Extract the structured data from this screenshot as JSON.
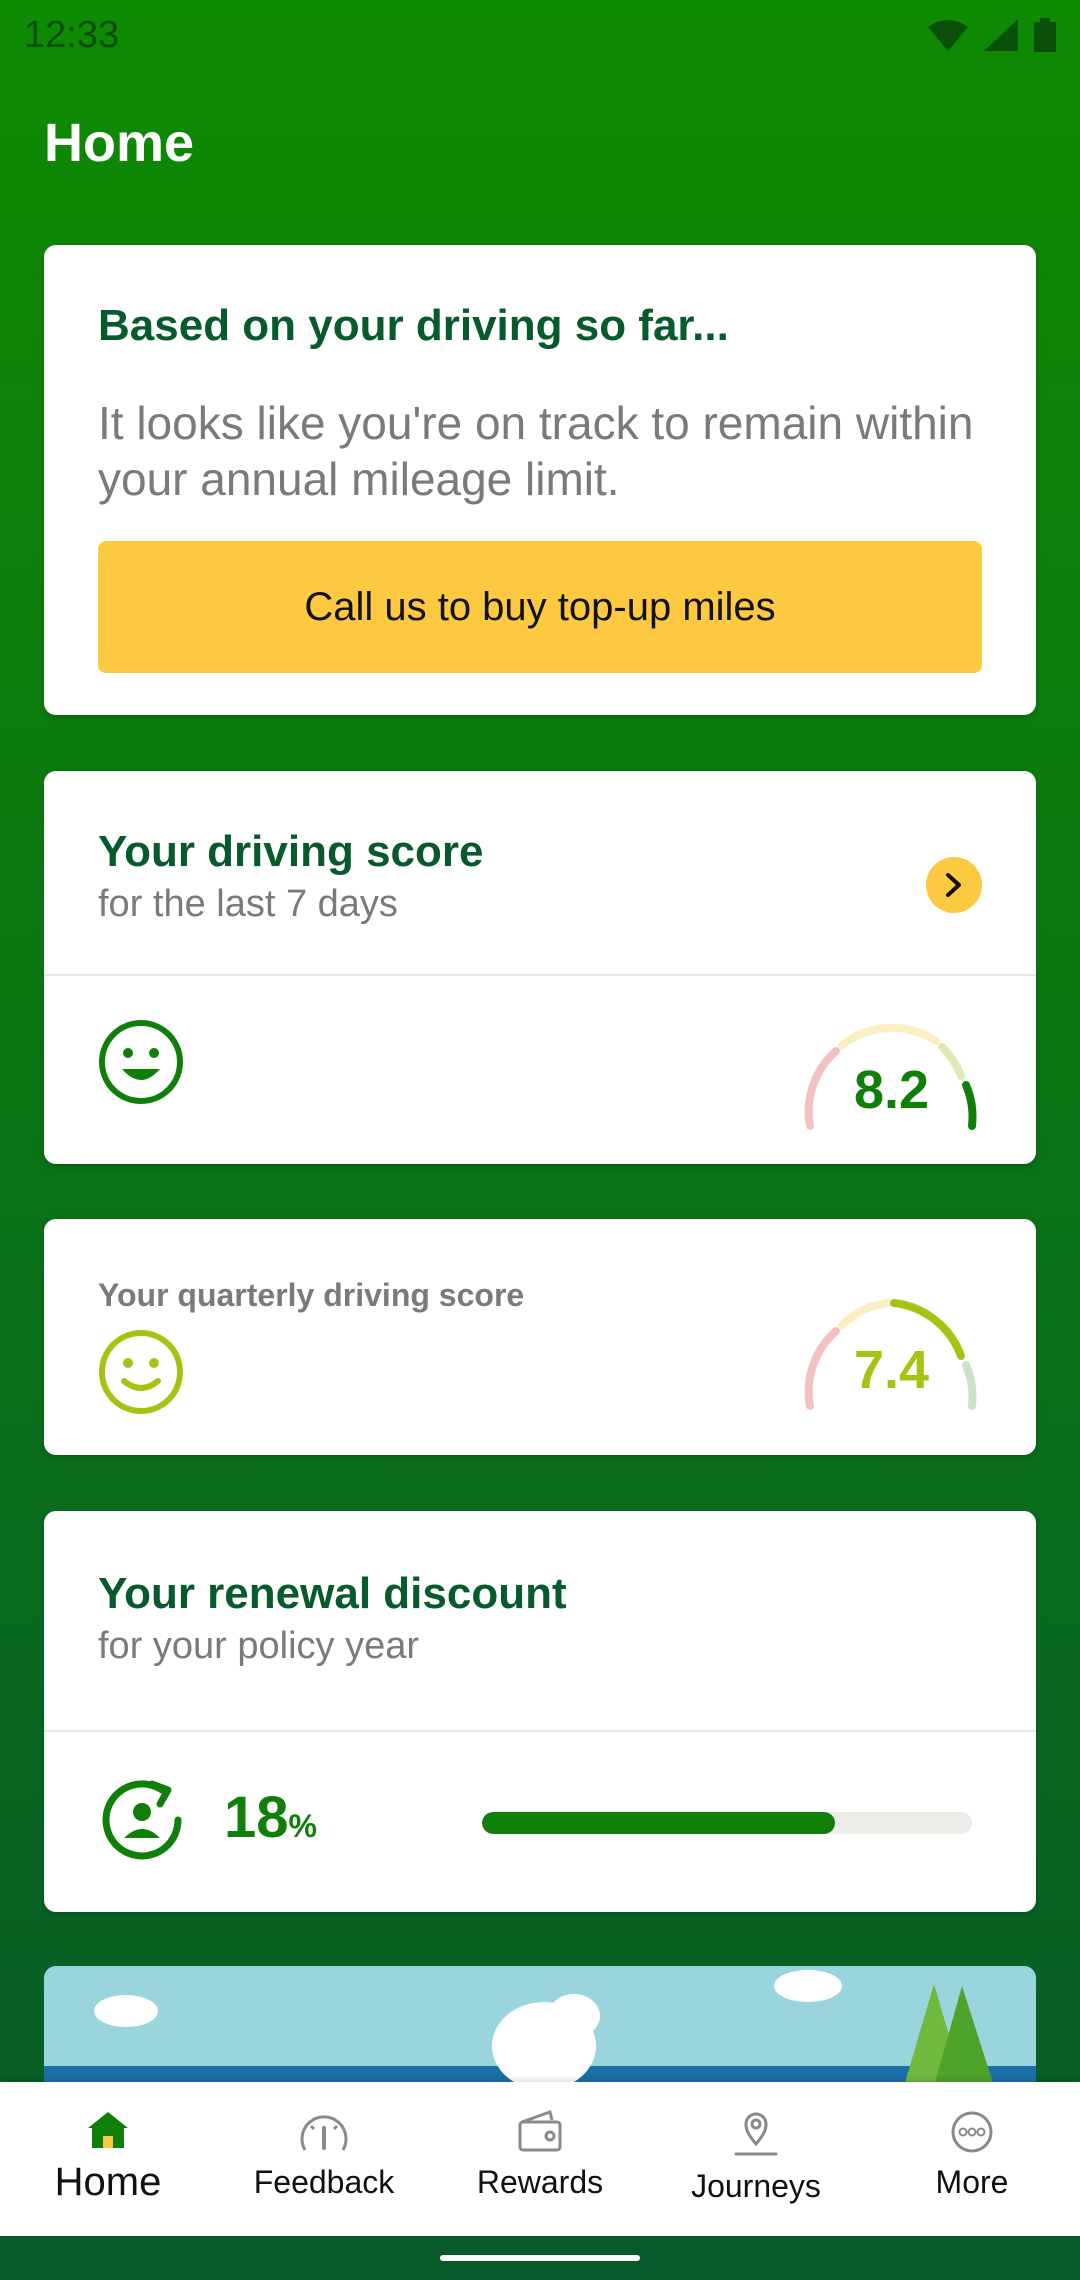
{
  "status_bar": {
    "time": "12:33"
  },
  "header": {
    "title": "Home"
  },
  "mileage_card": {
    "title": "Based on your driving so far...",
    "body": "It looks like you're on track to remain within your annual mileage limit.",
    "cta_label": "Call us to buy top-up miles"
  },
  "weekly_score": {
    "title": "Your driving score",
    "subtitle": "for the last 7 days",
    "score": "8.2",
    "score_color": "#0f7f0a"
  },
  "quarterly_score": {
    "title": "Your quarterly driving score",
    "score": "7.4",
    "score_color": "#a8c214"
  },
  "renewal": {
    "title": "Your renewal discount",
    "subtitle": "for your policy year",
    "value": "18",
    "unit": "%",
    "progress_fraction": 0.72
  },
  "bottom_nav": {
    "items": [
      {
        "label": "Home",
        "icon": "home-icon",
        "active": true
      },
      {
        "label": "Feedback",
        "icon": "speedometer-icon",
        "active": false
      },
      {
        "label": "Rewards",
        "icon": "wallet-icon",
        "active": false
      },
      {
        "label": "Journeys",
        "icon": "location-pin-icon",
        "active": false
      },
      {
        "label": "More",
        "icon": "more-dots-icon",
        "active": false
      }
    ]
  },
  "colors": {
    "brand_green": "#0f8a03",
    "accent_yellow": "#fcc940",
    "title_green": "#075a2c"
  }
}
